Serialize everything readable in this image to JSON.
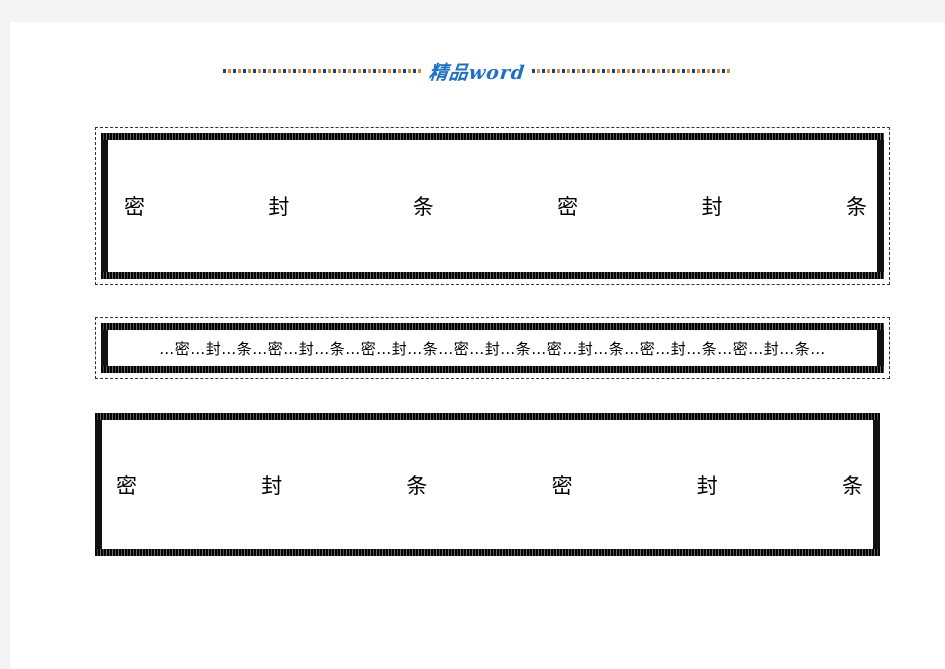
{
  "page": {
    "background_color": "#ffffff",
    "canvas_color": "#f4f4f4"
  },
  "watermark": {
    "text": "精品word",
    "color": "#1f6fc4",
    "rule_colors": [
      "#24426e",
      "#d98f3a"
    ]
  },
  "seal_boxes": [
    {
      "id": "seal-box-1",
      "style": "dashed-outer-thick-inner",
      "text_mode": "spaced",
      "characters": [
        "密",
        "封",
        "条",
        "密",
        "封",
        "条"
      ]
    },
    {
      "id": "seal-box-2",
      "style": "dashed-outer-thick-inner",
      "text_mode": "ellipsis",
      "text": "…密…封…条…密…封…条…密…封…条…密…封…条…密…封…条…密…封…条…密…封…条…"
    },
    {
      "id": "seal-box-3",
      "style": "thick-inner-only",
      "text_mode": "spaced",
      "characters": [
        "密",
        "封",
        "条",
        "密",
        "封",
        "条"
      ]
    }
  ]
}
